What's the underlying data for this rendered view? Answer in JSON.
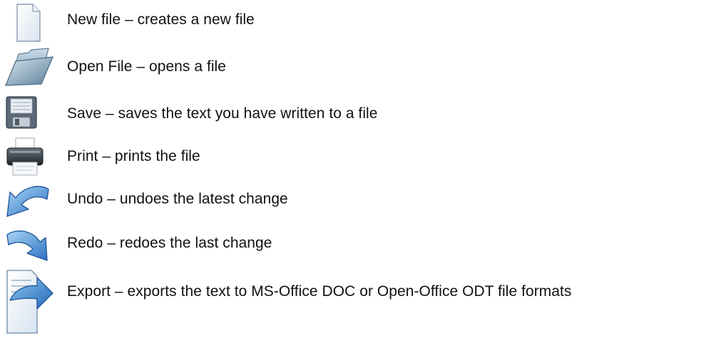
{
  "toolbar_legend": {
    "items": [
      {
        "icon": "new-file-icon",
        "label": "New file – creates a new file"
      },
      {
        "icon": "open-folder-icon",
        "label": "Open File – opens a file"
      },
      {
        "icon": "floppy-disk-icon",
        "label": "Save – saves the text you have written to a file"
      },
      {
        "icon": "printer-icon",
        "label": "Print – prints the file"
      },
      {
        "icon": "undo-arrow-icon",
        "label": "Undo – undoes the latest change"
      },
      {
        "icon": "redo-arrow-icon",
        "label": "Redo – redoes the last change"
      },
      {
        "icon": "export-document-icon",
        "label": "Export – exports the text to MS-Office DOC or Open-Office ODT file formats"
      }
    ]
  }
}
